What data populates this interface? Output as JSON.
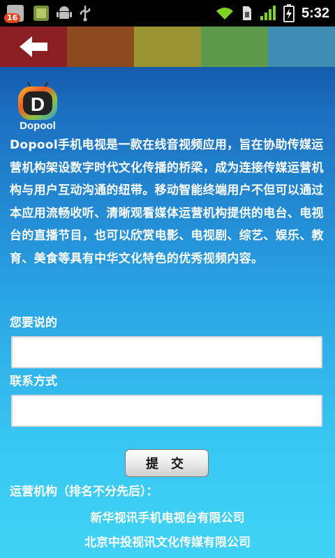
{
  "status_bar": {
    "notification_count": "16",
    "time": "5:32",
    "icons": [
      "notification-badge-icon",
      "app-icon",
      "android-icon",
      "usb-icon",
      "wifi-icon",
      "sim-icon",
      "signal-icon",
      "battery-charging-icon"
    ]
  },
  "toolbar": {
    "back_icon": "back-arrow-icon",
    "colors": [
      "#8a1f22",
      "#8d4a1e",
      "#9b9430",
      "#5c9a4a",
      "#3f8db3"
    ]
  },
  "app": {
    "logo_text": "Dopool",
    "description": "Dopool手机电视是一款在线音视频应用，旨在协助传媒运营机构架设数字时代文化传播的桥梁，成为连接传媒运营机构与用户互动沟通的纽带。移动智能终端用户不但可以通过本应用流畅收听、清晰观看媒体运营机构提供的电台、电视台的直播节目，也可以欣赏电影、电视剧、综艺、娱乐、教育、美食等具有中华文化特色的优秀视频内容。"
  },
  "form": {
    "feedback_label": "您要说的",
    "feedback_value": "",
    "contact_label": "联系方式",
    "contact_value": "",
    "submit_label": "提交"
  },
  "operators": {
    "title": "运营机构（排名不分先后）：",
    "items": [
      "新华视讯手机电视台有限公司",
      "北京中投视讯文化传媒有限公司"
    ]
  }
}
